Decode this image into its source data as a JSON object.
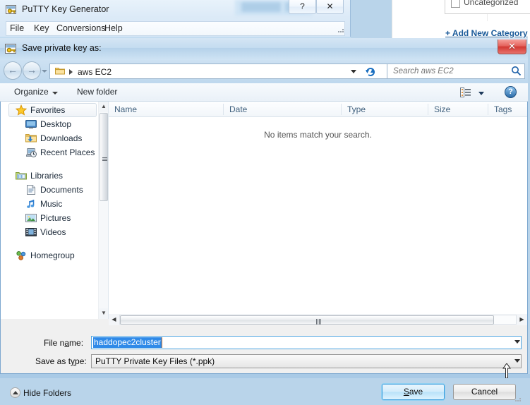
{
  "backdrop": {
    "category_checkbox_label": "Uncategorized",
    "add_category_link": "+ Add New Category"
  },
  "putty_window": {
    "title": "PuTTY Key Generator",
    "icon": "key-icon",
    "help_button": "?",
    "close_button": "✕",
    "menu": [
      "File",
      "Key",
      "Conversions",
      "Help"
    ]
  },
  "save_dialog": {
    "title": "Save private key as:",
    "icon": "key-icon",
    "close_button": "✕",
    "nav": {
      "back_arrow": "←",
      "forward_arrow": "→",
      "history_caret": "chevron-down-icon",
      "address_text": "aws EC2",
      "address_folder_icon": "folder-icon",
      "address_chevron": "chevron-right-icon",
      "address_dropdown": "chevron-down-icon",
      "refresh_icon": "refresh-icon",
      "search_placeholder": "Search aws EC2",
      "search_value": "",
      "search_icon": "search-icon"
    },
    "toolbar": {
      "organize_label": "Organize",
      "organize_caret": "chevron-down-icon",
      "new_folder_label": "New folder",
      "view_icon": "list-view-icon",
      "view_caret": "chevron-down-icon",
      "help_icon": "help-icon",
      "help_label": "?"
    },
    "sidebar": {
      "groups": [
        {
          "header": {
            "label": "Favorites",
            "icon": "star-icon",
            "selected": true
          },
          "items": [
            {
              "label": "Desktop",
              "icon": "desktop-icon"
            },
            {
              "label": "Downloads",
              "icon": "downloads-icon"
            },
            {
              "label": "Recent Places",
              "icon": "recent-places-icon"
            }
          ]
        },
        {
          "header": {
            "label": "Libraries",
            "icon": "libraries-icon",
            "selected": false
          },
          "items": [
            {
              "label": "Documents",
              "icon": "documents-icon"
            },
            {
              "label": "Music",
              "icon": "music-icon"
            },
            {
              "label": "Pictures",
              "icon": "pictures-icon"
            },
            {
              "label": "Videos",
              "icon": "videos-icon"
            }
          ]
        },
        {
          "header": {
            "label": "Homegroup",
            "icon": "homegroup-icon",
            "selected": false
          },
          "items": []
        }
      ],
      "scrollbar": {
        "up_arrow": "▲",
        "down_arrow": "▼"
      }
    },
    "file_list": {
      "columns": [
        "Name",
        "Date",
        "Type",
        "Size",
        "Tags"
      ],
      "sorted_column": "Type",
      "sort_direction": "ascending",
      "rows": [],
      "empty_message": "No items match your search.",
      "hscrollbar": {
        "left_arrow": "◀",
        "right_arrow": "▶"
      }
    },
    "form": {
      "file_name_label": "File name:",
      "file_name_value": "haddopec2cluster",
      "file_name_selected": true,
      "file_name_dropdown": "chevron-down-icon",
      "save_as_type_label": "Save as type:",
      "save_as_type_value": "PuTTY Private Key Files (*.ppk)",
      "save_as_type_dropdown": "chevron-down-icon"
    },
    "footer": {
      "hide_folders_label": "Hide Folders",
      "hide_folders_icon": "collapse-icon",
      "save_button": "Save",
      "cancel_button": "Cancel"
    }
  },
  "colors": {
    "accent_blue": "#2f8ae8",
    "title_gradient": "#c4dcf0",
    "close_red": "#d23a34",
    "link_blue": "#1a5a99",
    "column_header_text": "#41617e"
  }
}
